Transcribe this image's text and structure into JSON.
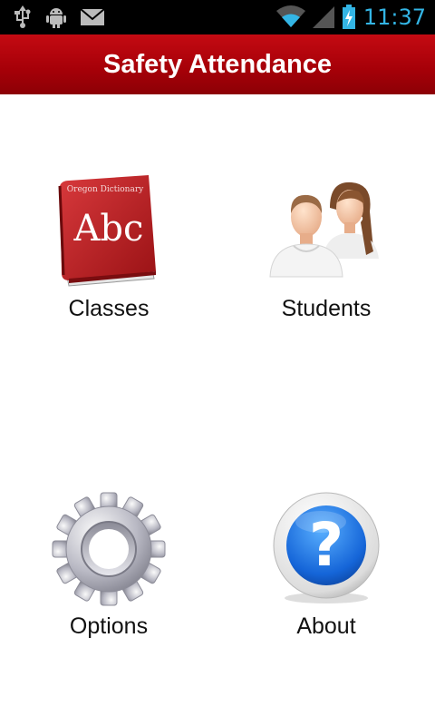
{
  "status_bar": {
    "time": "11:37",
    "icons": [
      "usb-icon",
      "android-debug-icon",
      "mail-icon",
      "wifi-icon",
      "signal-icon",
      "battery-charging-icon"
    ],
    "accent": "#33b5e5"
  },
  "header": {
    "title": "Safety Attendance",
    "color": "#a50008"
  },
  "menu": {
    "items": [
      {
        "label": "Classes",
        "icon": "book-icon"
      },
      {
        "label": "Students",
        "icon": "people-icon"
      },
      {
        "label": "Options",
        "icon": "gear-icon"
      },
      {
        "label": "About",
        "icon": "help-icon"
      }
    ]
  },
  "book": {
    "cover_text": "Abc",
    "cover_subtitle": "Oregon Dictionary"
  }
}
